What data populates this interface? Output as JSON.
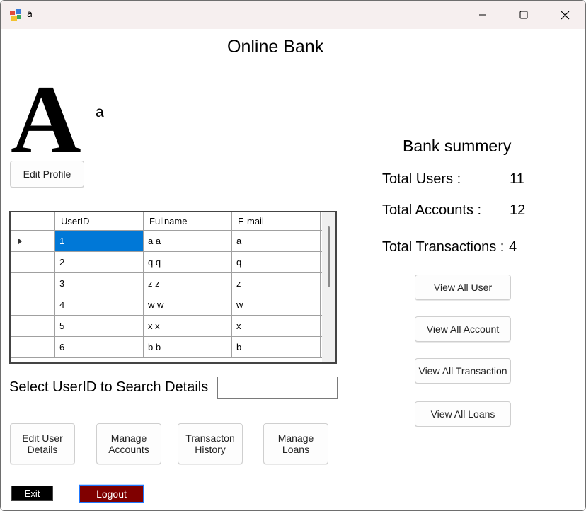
{
  "window": {
    "title": "a"
  },
  "header": {
    "title": "Online Bank"
  },
  "profile": {
    "avatar_letter": "A",
    "username": "a",
    "edit_label": "Edit Profile"
  },
  "users_grid": {
    "columns": [
      "UserID",
      "Fullname",
      "E-mail"
    ],
    "rows": [
      {
        "id": "1",
        "fullname": "a a",
        "email": "a"
      },
      {
        "id": "2",
        "fullname": "q q",
        "email": "q"
      },
      {
        "id": "3",
        "fullname": "z z",
        "email": "z"
      },
      {
        "id": "4",
        "fullname": "w w",
        "email": "w"
      },
      {
        "id": "5",
        "fullname": "x x",
        "email": "x"
      },
      {
        "id": "6",
        "fullname": "b b",
        "email": "b"
      }
    ],
    "selected_row": 0
  },
  "search": {
    "label": "Select UserID to Search Details",
    "value": ""
  },
  "actions": {
    "edit_user_details": "Edit User Details",
    "manage_accounts": "Manage Accounts",
    "transaction_history": "Transacton History",
    "manage_loans": "Manage Loans"
  },
  "footer": {
    "exit_label": "Exit",
    "logout_label": "Logout"
  },
  "summary": {
    "title": "Bank summery",
    "total_users_label": "Total Users :",
    "total_users_value": "11",
    "total_accounts_label": "Total Accounts :",
    "total_accounts_value": "12",
    "total_transactions_label": "Total Transactions :",
    "total_transactions_value": "4"
  },
  "view_buttons": {
    "all_user": "View All User",
    "all_account": "View All Account",
    "all_transaction": "View All Transaction",
    "all_loans": "View All Loans"
  },
  "colors": {
    "titlebar_bg": "#f6efef",
    "selected_cell": "#0078d7",
    "exit_bg": "#000000",
    "logout_bg": "#800000",
    "logout_border": "#1e78ff"
  },
  "icons": {
    "app": "app-icon",
    "minimize": "minimize-icon",
    "maximize": "maximize-icon",
    "close": "close-icon",
    "row_indicator": "row-indicator-arrow-icon"
  }
}
